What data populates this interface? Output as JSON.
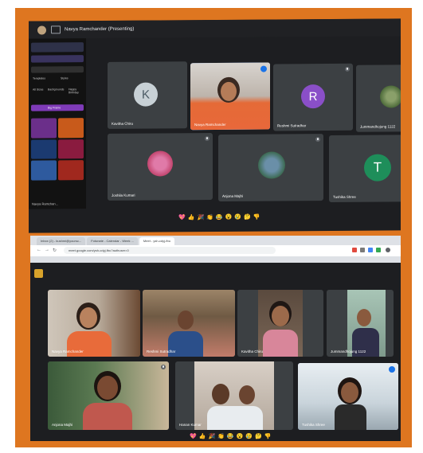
{
  "screen1": {
    "presenter_title": "Navya Ramchander (Presenting)",
    "sidebar_labels": [
      "Templates",
      "Styles",
      "All Sizes",
      "Backgrounds",
      "Happy Birthday",
      "Big Frame"
    ],
    "presentation_footer": "Navya Ramchan...",
    "participants": [
      {
        "name": "Kavitha Chiru",
        "avatar_letter": "K",
        "avatar_color": "#c8d1d6"
      },
      {
        "name": "Navya Ramchander",
        "speaking": true
      },
      {
        "name": "Reshmi Sutradhar",
        "avatar_letter": "R",
        "avatar_color": "#8a4fc8"
      },
      {
        "name": "Jummandhojung 1122"
      },
      {
        "name": "Joshila  Kumari"
      },
      {
        "name": "Anjona Majhi"
      },
      {
        "name": "Tushika Shree",
        "avatar_letter": "T",
        "avatar_color": "#1e8e5a"
      }
    ],
    "reactions": [
      "💖",
      "👍",
      "🎉",
      "👏",
      "😂",
      "😮",
      "😢",
      "🤔",
      "👎"
    ]
  },
  "screen2": {
    "tabs": [
      "Inbox (2) - kushmi@yoursc...",
      "Fotunate - Calendar - Week ...",
      "Meet - ysh-cdyj-fbu"
    ],
    "url": "meet.google.com/ysh-cdyj-fbu?authuser=0",
    "participants": [
      {
        "name": "Navya Ramchander"
      },
      {
        "name": "Reshmi Sutradhar"
      },
      {
        "name": "Kavitha Chiru"
      },
      {
        "name": "Jummandhojung 1122"
      },
      {
        "name": "Anjona Majhi"
      },
      {
        "name": "Hanan Kumar"
      },
      {
        "name": "Tushika Shree",
        "speaking": true
      }
    ],
    "reactions": [
      "💖",
      "👍",
      "🎉",
      "👏",
      "😂",
      "😮",
      "😢",
      "🤔",
      "👎"
    ]
  },
  "colors": {
    "frame": "#de7620",
    "meet_bg": "#1d1e21",
    "tile": "#3c4043",
    "speaking_outline": "#8ab4f8"
  }
}
